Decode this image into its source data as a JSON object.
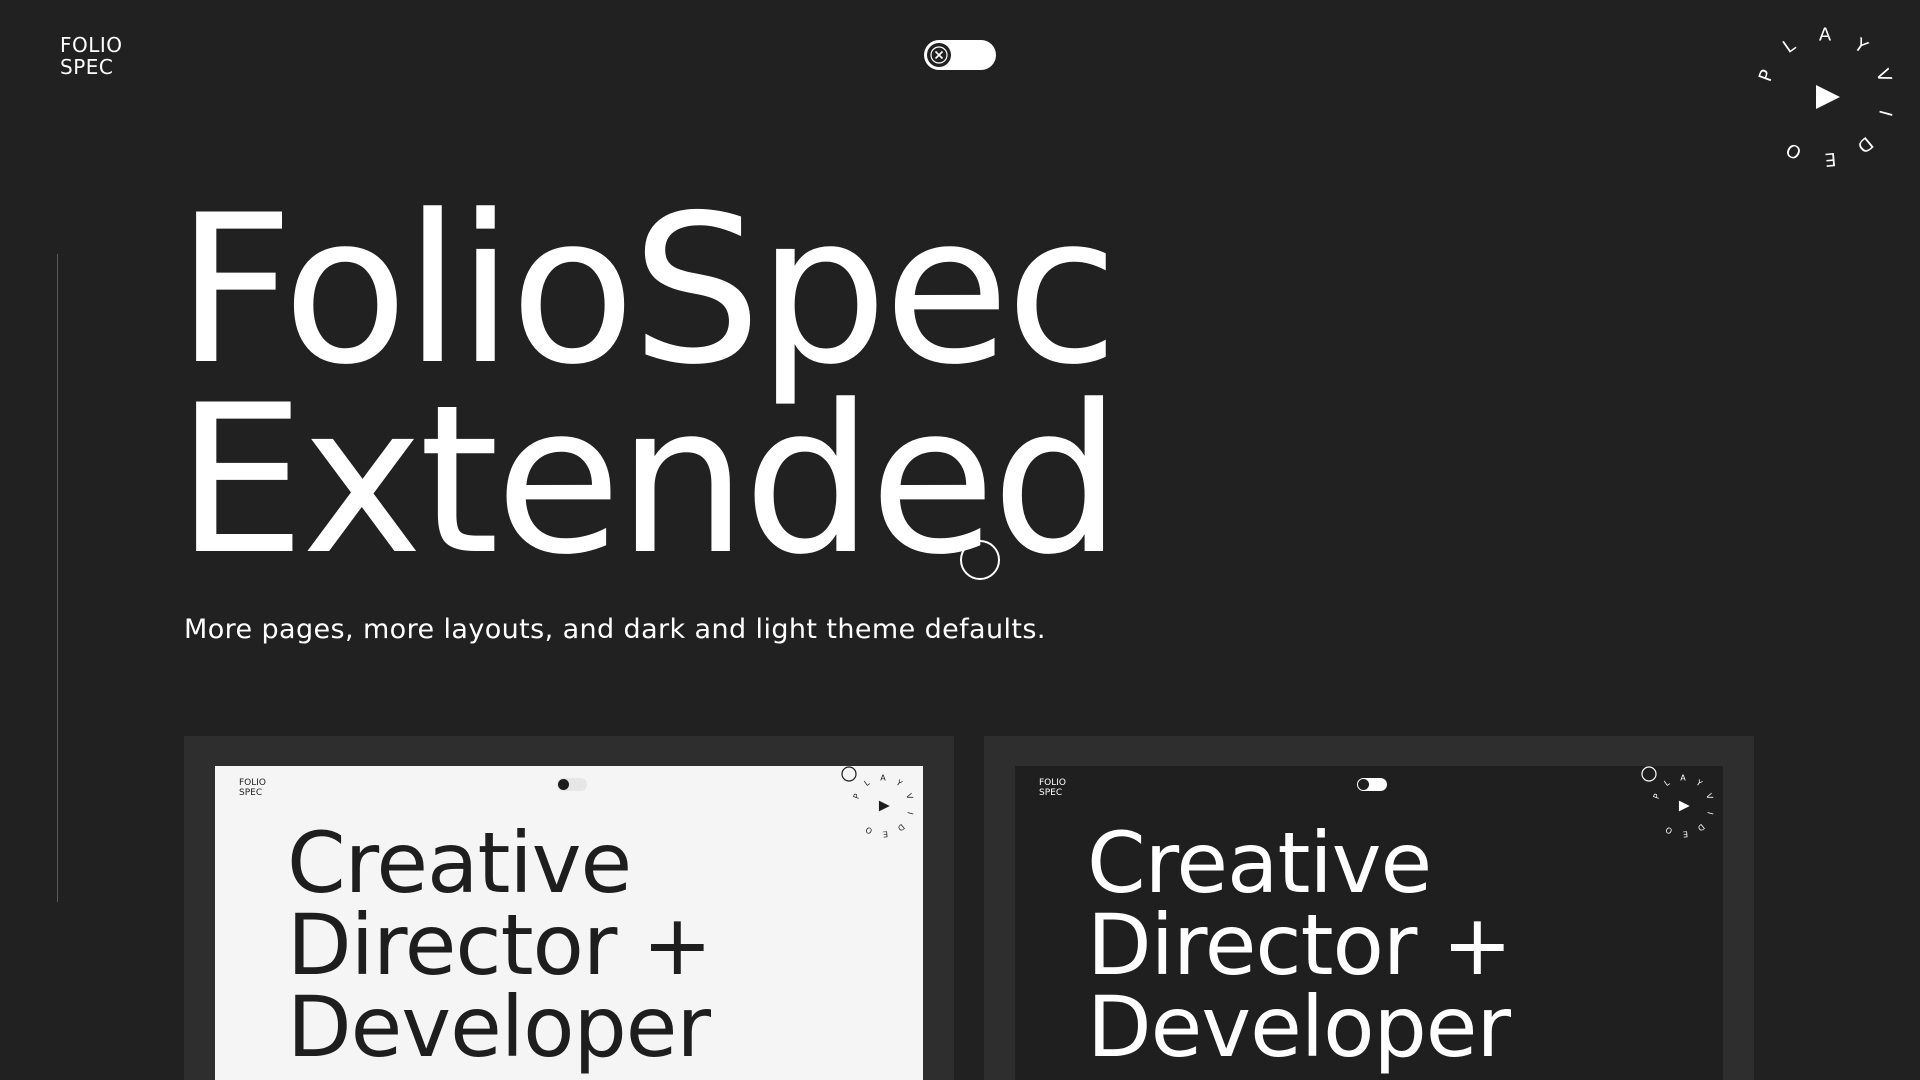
{
  "header": {
    "logo_line1": "FOLIO",
    "logo_line2": "SPEC",
    "theme_toggle_icon": "close-icon",
    "play_video": {
      "letters": [
        "P",
        "L",
        "A",
        "Y",
        "V",
        "I",
        "D",
        "E",
        "O"
      ],
      "icon": "play-icon"
    }
  },
  "hero": {
    "title_line1": "FolioSpec",
    "title_line2": "Extended",
    "subtitle": "More pages, more layouts, and dark and light theme defaults."
  },
  "previews": [
    {
      "theme": "light",
      "logo_line1": "FOLIO",
      "logo_line2": "SPEC",
      "title_line1": "Creative",
      "title_line2": "Director +",
      "title_line3": "Developer",
      "play_letters": [
        "P",
        "L",
        "A",
        "Y",
        "V",
        "I",
        "D",
        "E",
        "O"
      ]
    },
    {
      "theme": "dark",
      "logo_line1": "FOLIO",
      "logo_line2": "SPEC",
      "title_line1": "Creative",
      "title_line2": "Director +",
      "title_line3": "Developer",
      "play_letters": [
        "P",
        "L",
        "A",
        "Y",
        "V",
        "I",
        "D",
        "E",
        "O"
      ]
    }
  ],
  "colors": {
    "background": "#212121",
    "card": "#2e2e2e",
    "light_screen": "#f5f5f5",
    "foreground": "#ffffff"
  }
}
